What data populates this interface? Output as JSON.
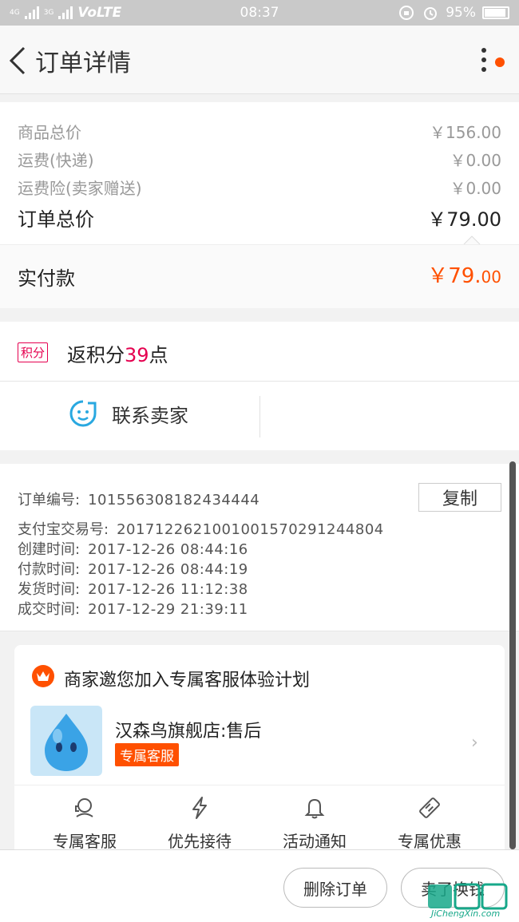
{
  "status_bar": {
    "network_left": "4G",
    "network_right": "3G",
    "carrier": "VoLTE",
    "time": "08:37",
    "battery": "95%"
  },
  "header": {
    "title": "订单详情"
  },
  "price": {
    "goods_total_label": "商品总价",
    "goods_total_value": "￥156.00",
    "shipping_label": "运费(快递)",
    "shipping_value": "￥0.00",
    "insurance_label": "运费险(卖家赠送)",
    "insurance_value": "￥0.00",
    "order_total_label": "订单总价",
    "order_total_value": "￥79.00",
    "paid_label": "实付款",
    "paid_value_int": "￥79.",
    "paid_value_dec": "00"
  },
  "points": {
    "badge": "积分",
    "prefix": "返积分",
    "count": "39",
    "suffix": "点"
  },
  "contact": {
    "label": "联系卖家"
  },
  "order_info": {
    "order_no_label": "订单编号:",
    "order_no": "101556308182434444",
    "copy_button": "复制",
    "alipay_label": "支付宝交易号:",
    "alipay_no": "2017122621001001570291244804",
    "created_label": "创建时间:",
    "created": "2017-12-26  08:44:16",
    "paid_label": "付款时间:",
    "paid": "2017-12-26  08:44:19",
    "shipped_label": "发货时间:",
    "shipped": "2017-12-26  11:12:38",
    "completed_label": "成交时间:",
    "completed": "2017-12-29  21:39:11"
  },
  "service_card": {
    "title": "商家邀您加入专属客服体验计划",
    "shop_name": "汉森鸟旗舰店:售后",
    "tag": "专属客服",
    "features": [
      {
        "label": "专属客服",
        "icon": "headset-icon"
      },
      {
        "label": "优先接待",
        "icon": "lightning-icon"
      },
      {
        "label": "活动通知",
        "icon": "bell-icon"
      },
      {
        "label": "专属优惠",
        "icon": "coupon-icon"
      }
    ]
  },
  "bottom_bar": {
    "delete_order": "删除订单",
    "sell_for_cash": "卖了换钱"
  },
  "watermark": {
    "text": "JiChengXin.com"
  },
  "colors": {
    "accent": "#ff5000",
    "points": "#e5004f",
    "contact_icon": "#29a8e0"
  }
}
